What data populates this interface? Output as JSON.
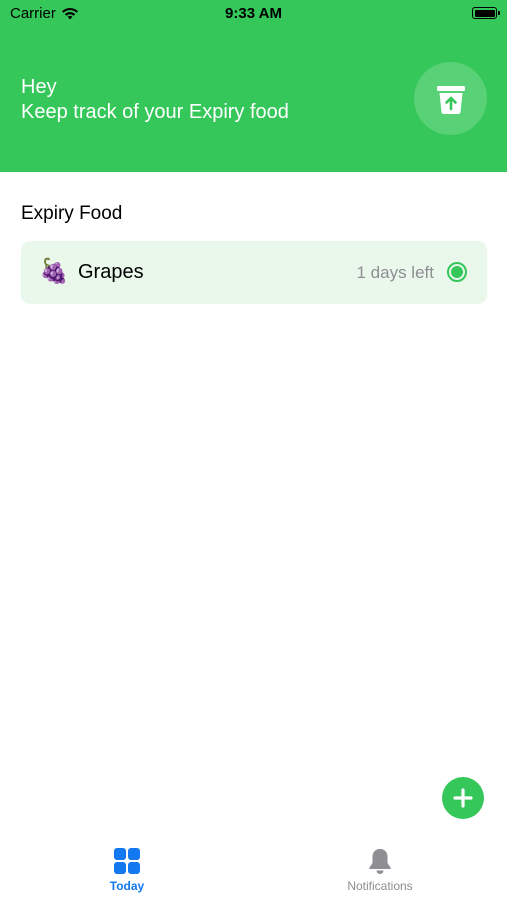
{
  "status_bar": {
    "carrier": "Carrier",
    "time": "9:33 AM",
    "icons": [
      "wifi-icon",
      "battery-icon"
    ]
  },
  "header": {
    "greeting_line1": "Hey",
    "greeting_line2": "Keep track of your Expiry food",
    "action_icon": "upload-bin-icon",
    "background_color": "#35C759"
  },
  "main": {
    "section_title": "Expiry Food",
    "items": [
      {
        "emoji": "🍇",
        "name": "Grapes",
        "days_left": "1 days left",
        "status_color": "#35C759"
      }
    ]
  },
  "fab": {
    "icon": "plus-icon",
    "color": "#35C759"
  },
  "tabbar": {
    "tabs": [
      {
        "label": "Today",
        "icon": "grid-icon",
        "active": true,
        "color": "#1478F0"
      },
      {
        "label": "Notifications",
        "icon": "bell-icon",
        "active": false,
        "color": "#8e8e93"
      }
    ]
  }
}
